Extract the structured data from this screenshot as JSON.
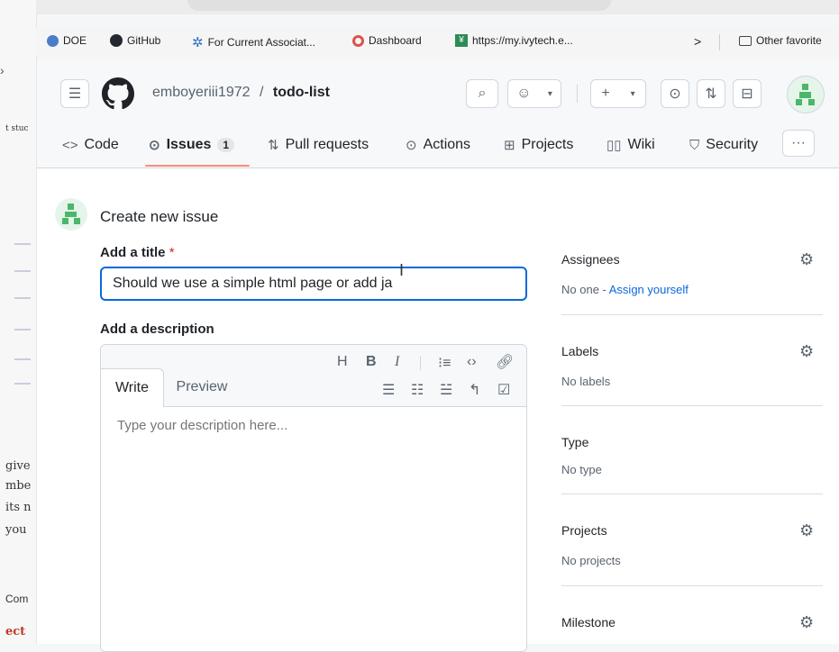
{
  "background_window": {
    "left_texts": [
      "t stuc",
      "give",
      "mbe",
      "its n",
      "you",
      "Com",
      "ect"
    ]
  },
  "bookmarks": {
    "items": [
      {
        "label": "DOE",
        "icon": "doe-icon"
      },
      {
        "label": "GitHub",
        "icon": "github-icon"
      },
      {
        "label": "For Current Associat...",
        "icon": "star-icon"
      },
      {
        "label": "Dashboard",
        "icon": "dashboard-icon"
      },
      {
        "label": "https://my.ivytech.e...",
        "icon": "ivytech-icon"
      }
    ],
    "overflow": ">",
    "other_favorites": "Other favorite"
  },
  "repo": {
    "owner": "emboyeriii1972",
    "separator": "/",
    "name": "todo-list"
  },
  "tabs": [
    {
      "label": "Code",
      "icon": "<>"
    },
    {
      "label": "Issues",
      "count": "1",
      "selected": true
    },
    {
      "label": "Pull requests"
    },
    {
      "label": "Actions"
    },
    {
      "label": "Projects"
    },
    {
      "label": "Wiki"
    },
    {
      "label": "Security"
    }
  ],
  "more_tabs": "···",
  "page": {
    "heading": "Create new issue",
    "title_label": "Add a title",
    "required_mark": "*",
    "title_value": "Should we use a simple html page or add ja",
    "description_label": "Add a description",
    "write_tab": "Write",
    "preview_tab": "Preview",
    "description_placeholder": "Type your description here..."
  },
  "toolbar": {
    "heading": "H",
    "bold": "B",
    "italic": "I"
  },
  "sidebar": {
    "assignees": {
      "title": "Assignees",
      "value_prefix": "No one - ",
      "link": "Assign yourself"
    },
    "labels": {
      "title": "Labels",
      "value": "No labels"
    },
    "type": {
      "title": "Type",
      "value": "No type"
    },
    "projects": {
      "title": "Projects",
      "value": "No projects"
    },
    "milestone": {
      "title": "Milestone"
    }
  },
  "colors": {
    "accent": "#0969da",
    "tab_underline": "#fd8c73",
    "avatar_green": "#4cb66a"
  }
}
